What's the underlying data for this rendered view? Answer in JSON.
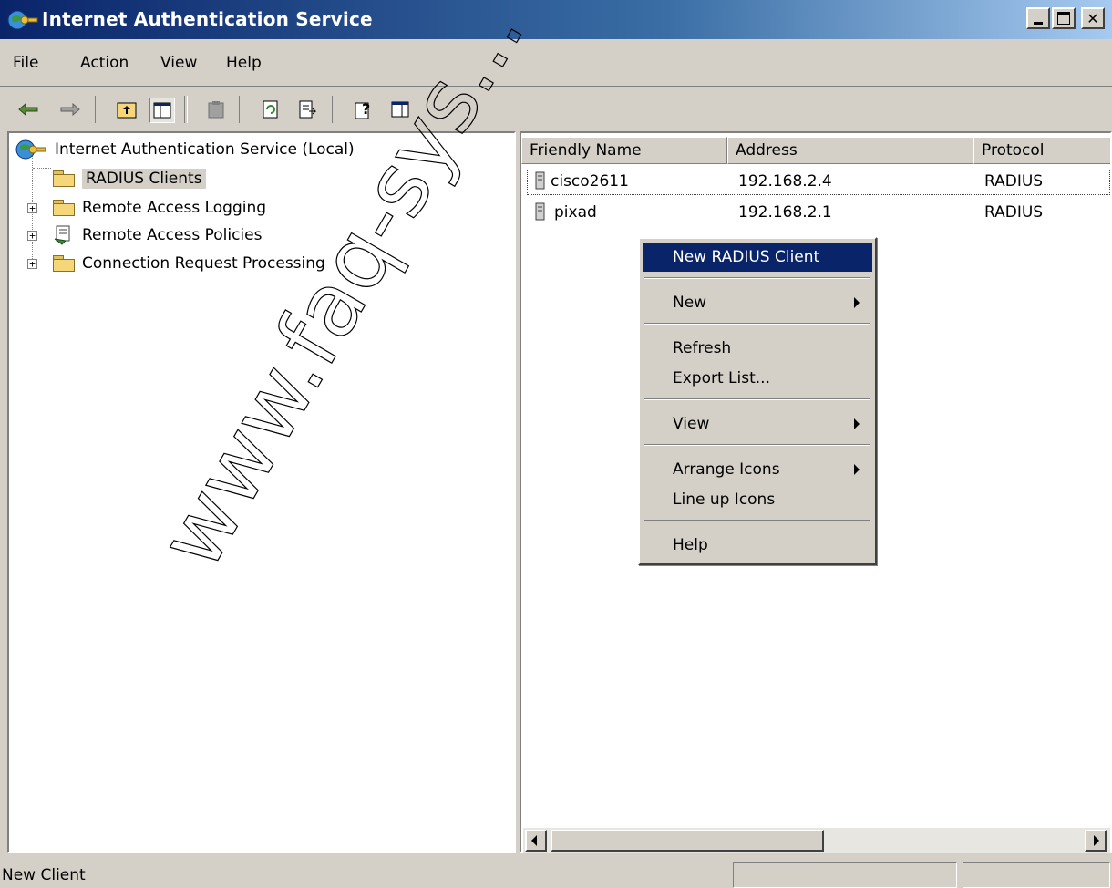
{
  "window": {
    "title": "Internet Authentication Service"
  },
  "menu": [
    "File",
    "Action",
    "View",
    "Help"
  ],
  "tree": {
    "root": "Internet Authentication Service (Local)",
    "items": [
      {
        "label": "RADIUS Clients",
        "selected": true,
        "expandable": false
      },
      {
        "label": "Remote Access Logging",
        "selected": false,
        "expandable": true
      },
      {
        "label": "Remote Access Policies",
        "selected": false,
        "expandable": true
      },
      {
        "label": "Connection Request Processing",
        "selected": false,
        "expandable": true
      }
    ]
  },
  "list": {
    "columns": [
      "Friendly Name",
      "Address",
      "Protocol"
    ],
    "rows": [
      {
        "name": "cisco2611",
        "address": "192.168.2.4",
        "protocol": "RADIUS"
      },
      {
        "name": "pixad",
        "address": "192.168.2.1",
        "protocol": "RADIUS"
      }
    ]
  },
  "context_menu": {
    "items": [
      {
        "label": "New RADIUS Client",
        "highlighted": true,
        "submenu": false
      },
      {
        "label": "New",
        "submenu": true
      },
      {
        "label": "Refresh",
        "submenu": false
      },
      {
        "label": "Export List...",
        "submenu": false
      },
      {
        "label": "View",
        "submenu": true
      },
      {
        "label": "Arrange Icons",
        "submenu": true
      },
      {
        "label": "Line up Icons",
        "submenu": false
      },
      {
        "label": "Help",
        "submenu": false
      }
    ]
  },
  "status": {
    "text": "New Client"
  },
  "watermark": "www.faq-sys..."
}
